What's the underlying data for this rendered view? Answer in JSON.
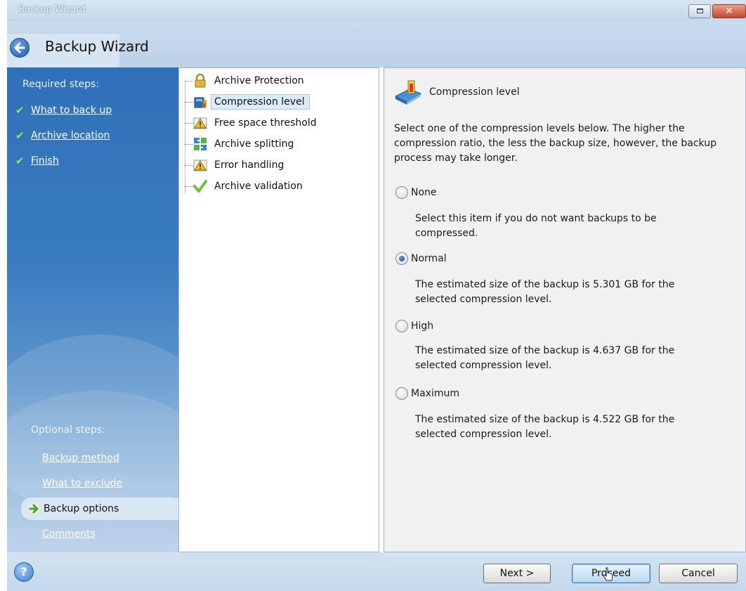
{
  "window": {
    "title": "Backup Wizard",
    "heading": "Backup Wizard"
  },
  "sidebar": {
    "required_title": "Required steps:",
    "required_steps": [
      {
        "label": "What to back up",
        "done": true
      },
      {
        "label": "Archive location",
        "done": true
      },
      {
        "label": "Finish",
        "done": true
      }
    ],
    "optional_title": "Optional steps:",
    "optional_steps": [
      {
        "label": "Backup method"
      },
      {
        "label": "What to exclude"
      },
      {
        "label": "Backup options",
        "selected": true
      },
      {
        "label": "Comments"
      }
    ]
  },
  "tree": {
    "items": [
      {
        "label": "Archive Protection",
        "icon": "lock-icon"
      },
      {
        "label": "Compression level",
        "icon": "compression-icon",
        "selected": true
      },
      {
        "label": "Free space threshold",
        "icon": "warning-icon"
      },
      {
        "label": "Archive splitting",
        "icon": "split-icon"
      },
      {
        "label": "Error handling",
        "icon": "warning-icon"
      },
      {
        "label": "Archive validation",
        "icon": "checkmark-icon"
      }
    ]
  },
  "content": {
    "title": "Compression level",
    "description": "Select one of the compression levels below. The higher the compression ratio, the less the backup size, however, the backup process may take longer.",
    "options": [
      {
        "label": "None",
        "description": "Select this item if you do not want backups to be compressed.",
        "selected": false
      },
      {
        "label": "Normal",
        "description": "The estimated size of the backup is 5.301 GB for the selected compression level.",
        "selected": true
      },
      {
        "label": "High",
        "description": "The estimated size of the backup is 4.637 GB for the selected compression level.",
        "selected": false
      },
      {
        "label": "Maximum",
        "description": "The estimated size of the backup is 4.522 GB for the selected compression level.",
        "selected": false
      }
    ]
  },
  "footer": {
    "help_label": "?",
    "next_label": "Next >",
    "proceed_label": "Proceed",
    "cancel_label": "Cancel"
  },
  "colors": {
    "sidebar_top": "#2f70b8",
    "accent_check": "#9ee35a",
    "selection": "#dcebf8"
  }
}
